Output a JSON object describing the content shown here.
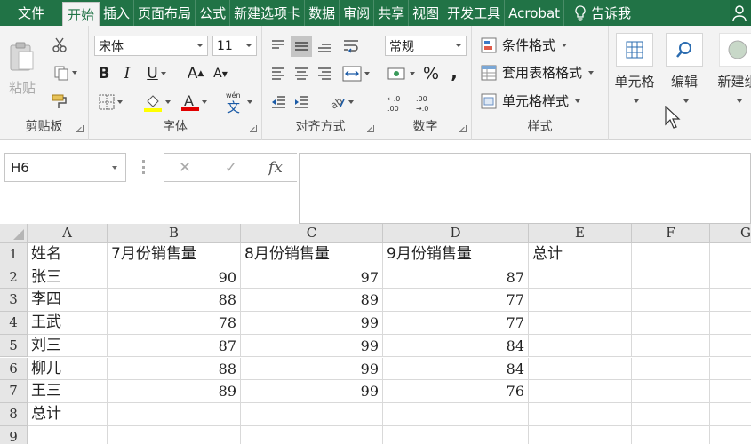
{
  "ribbon_tabs": [
    "文件",
    "开始",
    "插入",
    "页面布局",
    "公式",
    "新建选项卡",
    "数据",
    "审阅",
    "共享",
    "视图",
    "开发工具",
    "Acrobat"
  ],
  "tell_me": "告诉我",
  "clipboard": {
    "paste": "粘贴",
    "group": "剪贴板"
  },
  "font": {
    "name": "宋体",
    "size": "11",
    "group": "字体"
  },
  "alignment": {
    "group": "对齐方式"
  },
  "number": {
    "format": "常规",
    "percent": "%",
    "comma": ",",
    "group": "数字"
  },
  "styles": {
    "conditional": "条件格式",
    "table": "套用表格格式",
    "cell": "单元格样式",
    "group": "样式"
  },
  "cells_button": "单元格",
  "editing_button": "编辑",
  "new_button": "新建组",
  "formula_bar": {
    "name_box": "H6",
    "fx": "fx",
    "content": ""
  },
  "columns": [
    "A",
    "B",
    "C",
    "D",
    "E",
    "F",
    "G"
  ],
  "rows": [
    "1",
    "2",
    "3",
    "4",
    "5",
    "6",
    "7",
    "8",
    "9"
  ],
  "cells": [
    [
      "姓名",
      "7月份销售量",
      "8月份销售量",
      "9月份销售量",
      "总计",
      "",
      ""
    ],
    [
      "张三",
      "90",
      "97",
      "87",
      "",
      "",
      ""
    ],
    [
      "李四",
      "88",
      "89",
      "77",
      "",
      "",
      ""
    ],
    [
      "王武",
      "78",
      "99",
      "77",
      "",
      "",
      ""
    ],
    [
      "刘三",
      "87",
      "99",
      "84",
      "",
      "",
      ""
    ],
    [
      "柳儿",
      "88",
      "99",
      "84",
      "",
      "",
      ""
    ],
    [
      "王三",
      "89",
      "99",
      "76",
      "",
      "",
      ""
    ],
    [
      "总计",
      "",
      "",
      "",
      "",
      "",
      ""
    ],
    [
      "",
      "",
      "",
      "",
      "",
      "",
      ""
    ]
  ],
  "colors": {
    "brand": "#217346",
    "ribbon_bg": "#f3f3f3",
    "grid_line": "#d9d9d9"
  }
}
